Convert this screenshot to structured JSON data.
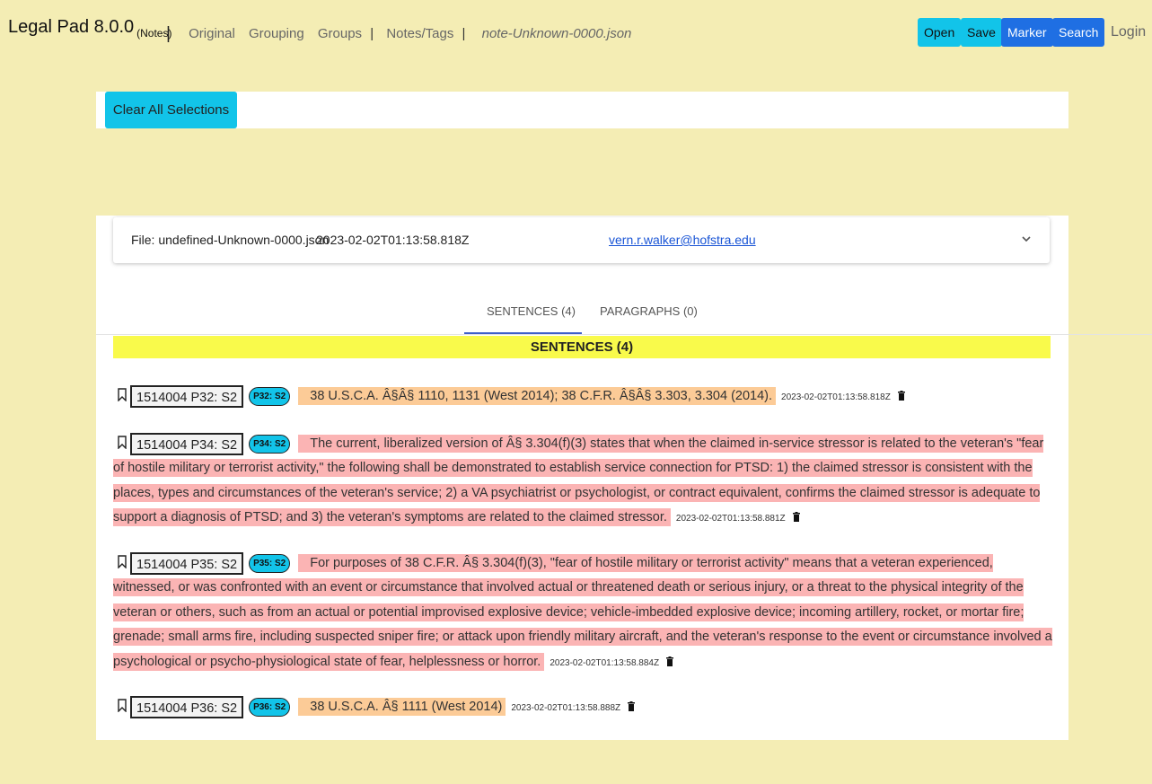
{
  "header": {
    "app_name": "Legal Pad 8.0.0",
    "app_subtitle": "(Notes)",
    "separator": "|",
    "nav": [
      "Original",
      "Grouping",
      "Groups"
    ],
    "nav_bar": "|",
    "nav_notes": "Notes/Tags",
    "nav_bar2": "|",
    "file_name": "note-Unknown-0000.json",
    "buttons": {
      "open": "Open",
      "save": "Save",
      "marker": "Marker",
      "search": "Search"
    },
    "login": "Login"
  },
  "toolbar": {
    "clear_all": "Clear All Selections"
  },
  "file_card": {
    "file_label": "File: undefined-Unknown-0000.json",
    "timestamp": "2023-02-02T01:13:58.818Z",
    "email": "vern.r.walker@hofstra.edu",
    "chevron": "⌄"
  },
  "tabs": {
    "sentences": "SENTENCES (4)",
    "paragraphs": "PARAGRAPHS (0)"
  },
  "sentences_header": "SENTENCES (4)",
  "sentences": [
    {
      "id": "1514004 P32: S2",
      "tag": "P32: S2",
      "text": "38 U.S.C.A. Â§Â§ 1110, 1131 (West 2014); 38 C.F.R. Â§Â§ 3.303, 3.304 (2014).",
      "timestamp": "2023-02-02T01:13:58.818Z",
      "highlight": "#fccb97"
    },
    {
      "id": "1514004 P34: S2",
      "tag": "P34: S2",
      "text": "The current, liberalized version of Â§ 3.304(f)(3) states that when the claimed in-service stressor is related to the veteran's \"fear of hostile military or terrorist activity,\" the following shall be demonstrated to establish service connection for PTSD: 1) the claimed stressor is consistent with the places, types and circumstances of the veteran's service; 2) a VA psychiatrist or psychologist, or contract equivalent, confirms the claimed stressor is adequate to support a diagnosis of PTSD; and 3) the veteran's symptoms are related to the claimed stressor.",
      "timestamp": "2023-02-02T01:13:58.881Z",
      "highlight": "#fbb4b4"
    },
    {
      "id": "1514004 P35: S2",
      "tag": "P35: S2",
      "text": "For purposes of 38 C.F.R. Â§ 3.304(f)(3), \"fear of hostile military or terrorist activity\" means that a veteran experienced, witnessed, or was confronted with an event or circumstance that involved actual or threatened death or serious injury, or a threat to the physical integrity of the veteran or others, such as from an actual or potential improvised explosive device; vehicle-imbedded explosive device; incoming artillery, rocket, or mortar fire; grenade; small arms fire, including suspected sniper fire; or attack upon friendly military aircraft, and the veteran's response to the event or circumstance involved a psychological or psycho-physiological state of fear, helplessness or horror.",
      "timestamp": "2023-02-02T01:13:58.884Z",
      "highlight": "#fbb4b4"
    },
    {
      "id": "1514004 P36: S2",
      "tag": "P36: S2",
      "text": "38 U.S.C.A. Â§ 1111 (West 2014)",
      "timestamp": "2023-02-02T01:13:58.888Z",
      "highlight": "#fccb97"
    }
  ],
  "colors": {
    "background": "#f4edb4",
    "cyan_button": "#12c4e9",
    "blue_button": "#1f6fe3",
    "header_bar": "#f9fa4b",
    "citation_highlight": "#fccb97",
    "sentence_highlight": "#fbb4b4"
  }
}
